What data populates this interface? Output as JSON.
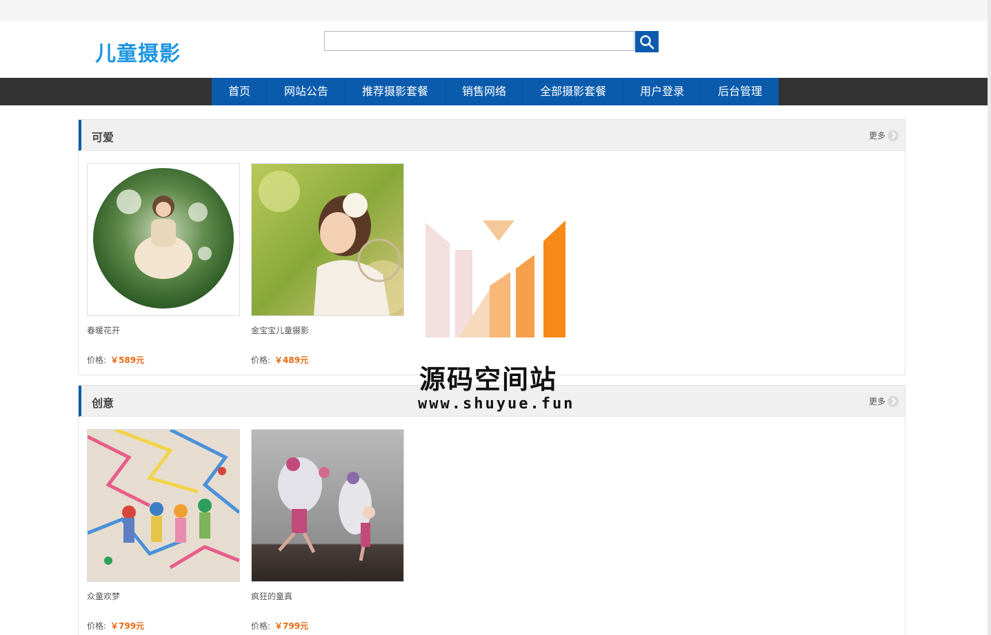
{
  "site": {
    "logo_text": "儿童摄影",
    "search_placeholder": ""
  },
  "nav": {
    "items": [
      "首页",
      "网站公告",
      "推荐摄影套餐",
      "销售网络",
      "全部摄影套餐",
      "用户登录",
      "后台管理"
    ]
  },
  "sections": [
    {
      "title": "可爱",
      "more_label": "更多",
      "products": [
        {
          "name": "春暖花开",
          "price_label": "价格:",
          "price": "￥589元"
        },
        {
          "name": "金宝宝儿童摄影",
          "price_label": "价格:",
          "price": "￥489元"
        }
      ]
    },
    {
      "title": "创意",
      "more_label": "更多",
      "products": [
        {
          "name": "众童欢梦",
          "price_label": "价格:",
          "price": "￥799元"
        },
        {
          "name": "疯狂的童真",
          "price_label": "价格:",
          "price": "￥799元"
        }
      ]
    }
  ],
  "watermark": {
    "title": "源码空间站",
    "url": "www.shuyue.fun"
  },
  "colors": {
    "brand_blue": "#0b5bad",
    "logo_blue": "#1e96e0",
    "price_orange": "#e86a12",
    "nav_dark": "#333333"
  }
}
